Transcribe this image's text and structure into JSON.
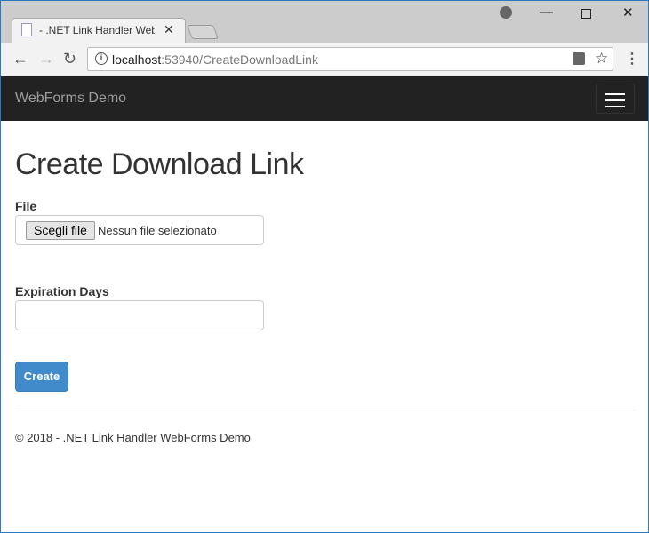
{
  "browser": {
    "tab_title": "- .NET Link Handler WebForms Demo",
    "url_host": "localhost",
    "url_path": ":53940/CreateDownloadLink"
  },
  "navbar": {
    "brand": "WebForms Demo"
  },
  "page": {
    "title": "Create Download Link",
    "file_label": "File",
    "choose_button": "Scegli file",
    "no_file": "Nessun file selezionato",
    "expiration_label": "Expiration Days",
    "expiration_value": "",
    "create_button": "Create"
  },
  "footer": {
    "text": "© 2018 - .NET Link Handler WebForms Demo"
  }
}
